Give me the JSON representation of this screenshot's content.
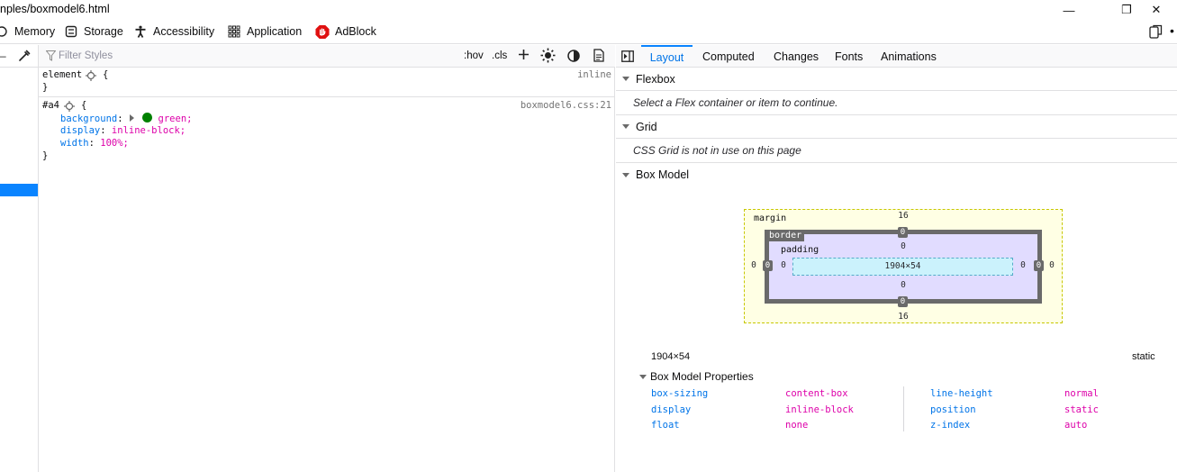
{
  "window": {
    "title": "nples/boxmodel6.html",
    "controls": [
      "—",
      "❐",
      "✕"
    ]
  },
  "toolbox": {
    "tabs": [
      {
        "label": "Memory",
        "icon": "memory-icon"
      },
      {
        "label": "Storage",
        "icon": "storage-icon"
      },
      {
        "label": "Accessibility",
        "icon": "accessibility-icon"
      },
      {
        "label": "Application",
        "icon": "application-icon"
      },
      {
        "label": "AdBlock",
        "icon": "adblock-icon"
      }
    ]
  },
  "rules": {
    "filter_placeholder": "Filter Styles",
    "hov_label": ":hov",
    "cls_label": ".cls",
    "element_rule": {
      "selector": "element",
      "source": "inline",
      "open": "{",
      "close": "}"
    },
    "rule1": {
      "selector": "#a4",
      "source": "boxmodel6.css:21",
      "open": "{",
      "close": "}",
      "declarations": [
        {
          "name": "background",
          "value": "green;"
        },
        {
          "name": "display",
          "value": "inline-block;"
        },
        {
          "name": "width",
          "value": "100%;"
        }
      ]
    }
  },
  "layout": {
    "tabs": [
      "Layout",
      "Computed",
      "Changes",
      "Fonts",
      "Animations"
    ],
    "active_tab": "Layout",
    "flexbox": {
      "title": "Flexbox",
      "message": "Select a Flex container or item to continue."
    },
    "grid": {
      "title": "Grid",
      "message": "CSS Grid is not in use on this page"
    },
    "boxmodel": {
      "title": "Box Model",
      "margin_label": "margin",
      "border_label": "border",
      "padding_label": "padding",
      "margin": {
        "top": "16",
        "right": "0",
        "bottom": "16",
        "left": "0"
      },
      "border": {
        "top": "0",
        "right": "0",
        "bottom": "0",
        "left": "0"
      },
      "padding": {
        "top": "0",
        "right": "0",
        "bottom": "0",
        "left": "0"
      },
      "content": "1904×54",
      "size": "1904×54",
      "position": "static",
      "props_title": "Box Model Properties",
      "props": [
        {
          "name": "box-sizing",
          "value": "content-box"
        },
        {
          "name": "display",
          "value": "inline-block"
        },
        {
          "name": "float",
          "value": "none"
        },
        {
          "name": "line-height",
          "value": "normal"
        },
        {
          "name": "position",
          "value": "static"
        },
        {
          "name": "z-index",
          "value": "auto"
        }
      ]
    }
  },
  "colors": {
    "accent": "#0a84ff",
    "swatch": "#008000"
  }
}
